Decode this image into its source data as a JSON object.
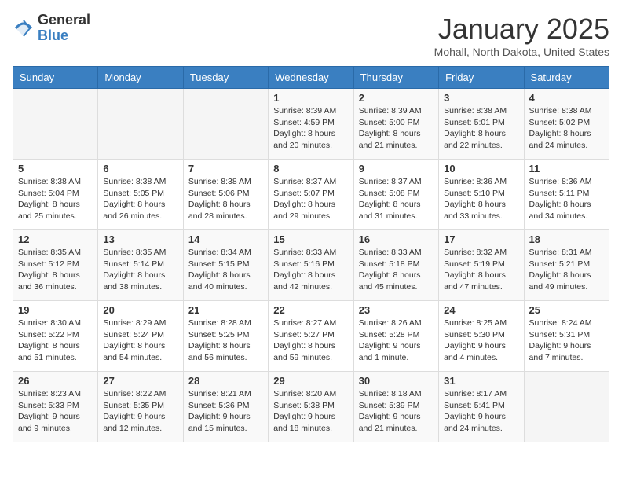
{
  "header": {
    "logo_general": "General",
    "logo_blue": "Blue",
    "month_title": "January 2025",
    "location": "Mohall, North Dakota, United States"
  },
  "weekdays": [
    "Sunday",
    "Monday",
    "Tuesday",
    "Wednesday",
    "Thursday",
    "Friday",
    "Saturday"
  ],
  "weeks": [
    [
      {
        "day": "",
        "info": ""
      },
      {
        "day": "",
        "info": ""
      },
      {
        "day": "",
        "info": ""
      },
      {
        "day": "1",
        "info": "Sunrise: 8:39 AM\nSunset: 4:59 PM\nDaylight: 8 hours\nand 20 minutes."
      },
      {
        "day": "2",
        "info": "Sunrise: 8:39 AM\nSunset: 5:00 PM\nDaylight: 8 hours\nand 21 minutes."
      },
      {
        "day": "3",
        "info": "Sunrise: 8:38 AM\nSunset: 5:01 PM\nDaylight: 8 hours\nand 22 minutes."
      },
      {
        "day": "4",
        "info": "Sunrise: 8:38 AM\nSunset: 5:02 PM\nDaylight: 8 hours\nand 24 minutes."
      }
    ],
    [
      {
        "day": "5",
        "info": "Sunrise: 8:38 AM\nSunset: 5:04 PM\nDaylight: 8 hours\nand 25 minutes."
      },
      {
        "day": "6",
        "info": "Sunrise: 8:38 AM\nSunset: 5:05 PM\nDaylight: 8 hours\nand 26 minutes."
      },
      {
        "day": "7",
        "info": "Sunrise: 8:38 AM\nSunset: 5:06 PM\nDaylight: 8 hours\nand 28 minutes."
      },
      {
        "day": "8",
        "info": "Sunrise: 8:37 AM\nSunset: 5:07 PM\nDaylight: 8 hours\nand 29 minutes."
      },
      {
        "day": "9",
        "info": "Sunrise: 8:37 AM\nSunset: 5:08 PM\nDaylight: 8 hours\nand 31 minutes."
      },
      {
        "day": "10",
        "info": "Sunrise: 8:36 AM\nSunset: 5:10 PM\nDaylight: 8 hours\nand 33 minutes."
      },
      {
        "day": "11",
        "info": "Sunrise: 8:36 AM\nSunset: 5:11 PM\nDaylight: 8 hours\nand 34 minutes."
      }
    ],
    [
      {
        "day": "12",
        "info": "Sunrise: 8:35 AM\nSunset: 5:12 PM\nDaylight: 8 hours\nand 36 minutes."
      },
      {
        "day": "13",
        "info": "Sunrise: 8:35 AM\nSunset: 5:14 PM\nDaylight: 8 hours\nand 38 minutes."
      },
      {
        "day": "14",
        "info": "Sunrise: 8:34 AM\nSunset: 5:15 PM\nDaylight: 8 hours\nand 40 minutes."
      },
      {
        "day": "15",
        "info": "Sunrise: 8:33 AM\nSunset: 5:16 PM\nDaylight: 8 hours\nand 42 minutes."
      },
      {
        "day": "16",
        "info": "Sunrise: 8:33 AM\nSunset: 5:18 PM\nDaylight: 8 hours\nand 45 minutes."
      },
      {
        "day": "17",
        "info": "Sunrise: 8:32 AM\nSunset: 5:19 PM\nDaylight: 8 hours\nand 47 minutes."
      },
      {
        "day": "18",
        "info": "Sunrise: 8:31 AM\nSunset: 5:21 PM\nDaylight: 8 hours\nand 49 minutes."
      }
    ],
    [
      {
        "day": "19",
        "info": "Sunrise: 8:30 AM\nSunset: 5:22 PM\nDaylight: 8 hours\nand 51 minutes."
      },
      {
        "day": "20",
        "info": "Sunrise: 8:29 AM\nSunset: 5:24 PM\nDaylight: 8 hours\nand 54 minutes."
      },
      {
        "day": "21",
        "info": "Sunrise: 8:28 AM\nSunset: 5:25 PM\nDaylight: 8 hours\nand 56 minutes."
      },
      {
        "day": "22",
        "info": "Sunrise: 8:27 AM\nSunset: 5:27 PM\nDaylight: 8 hours\nand 59 minutes."
      },
      {
        "day": "23",
        "info": "Sunrise: 8:26 AM\nSunset: 5:28 PM\nDaylight: 9 hours\nand 1 minute."
      },
      {
        "day": "24",
        "info": "Sunrise: 8:25 AM\nSunset: 5:30 PM\nDaylight: 9 hours\nand 4 minutes."
      },
      {
        "day": "25",
        "info": "Sunrise: 8:24 AM\nSunset: 5:31 PM\nDaylight: 9 hours\nand 7 minutes."
      }
    ],
    [
      {
        "day": "26",
        "info": "Sunrise: 8:23 AM\nSunset: 5:33 PM\nDaylight: 9 hours\nand 9 minutes."
      },
      {
        "day": "27",
        "info": "Sunrise: 8:22 AM\nSunset: 5:35 PM\nDaylight: 9 hours\nand 12 minutes."
      },
      {
        "day": "28",
        "info": "Sunrise: 8:21 AM\nSunset: 5:36 PM\nDaylight: 9 hours\nand 15 minutes."
      },
      {
        "day": "29",
        "info": "Sunrise: 8:20 AM\nSunset: 5:38 PM\nDaylight: 9 hours\nand 18 minutes."
      },
      {
        "day": "30",
        "info": "Sunrise: 8:18 AM\nSunset: 5:39 PM\nDaylight: 9 hours\nand 21 minutes."
      },
      {
        "day": "31",
        "info": "Sunrise: 8:17 AM\nSunset: 5:41 PM\nDaylight: 9 hours\nand 24 minutes."
      },
      {
        "day": "",
        "info": ""
      }
    ]
  ]
}
